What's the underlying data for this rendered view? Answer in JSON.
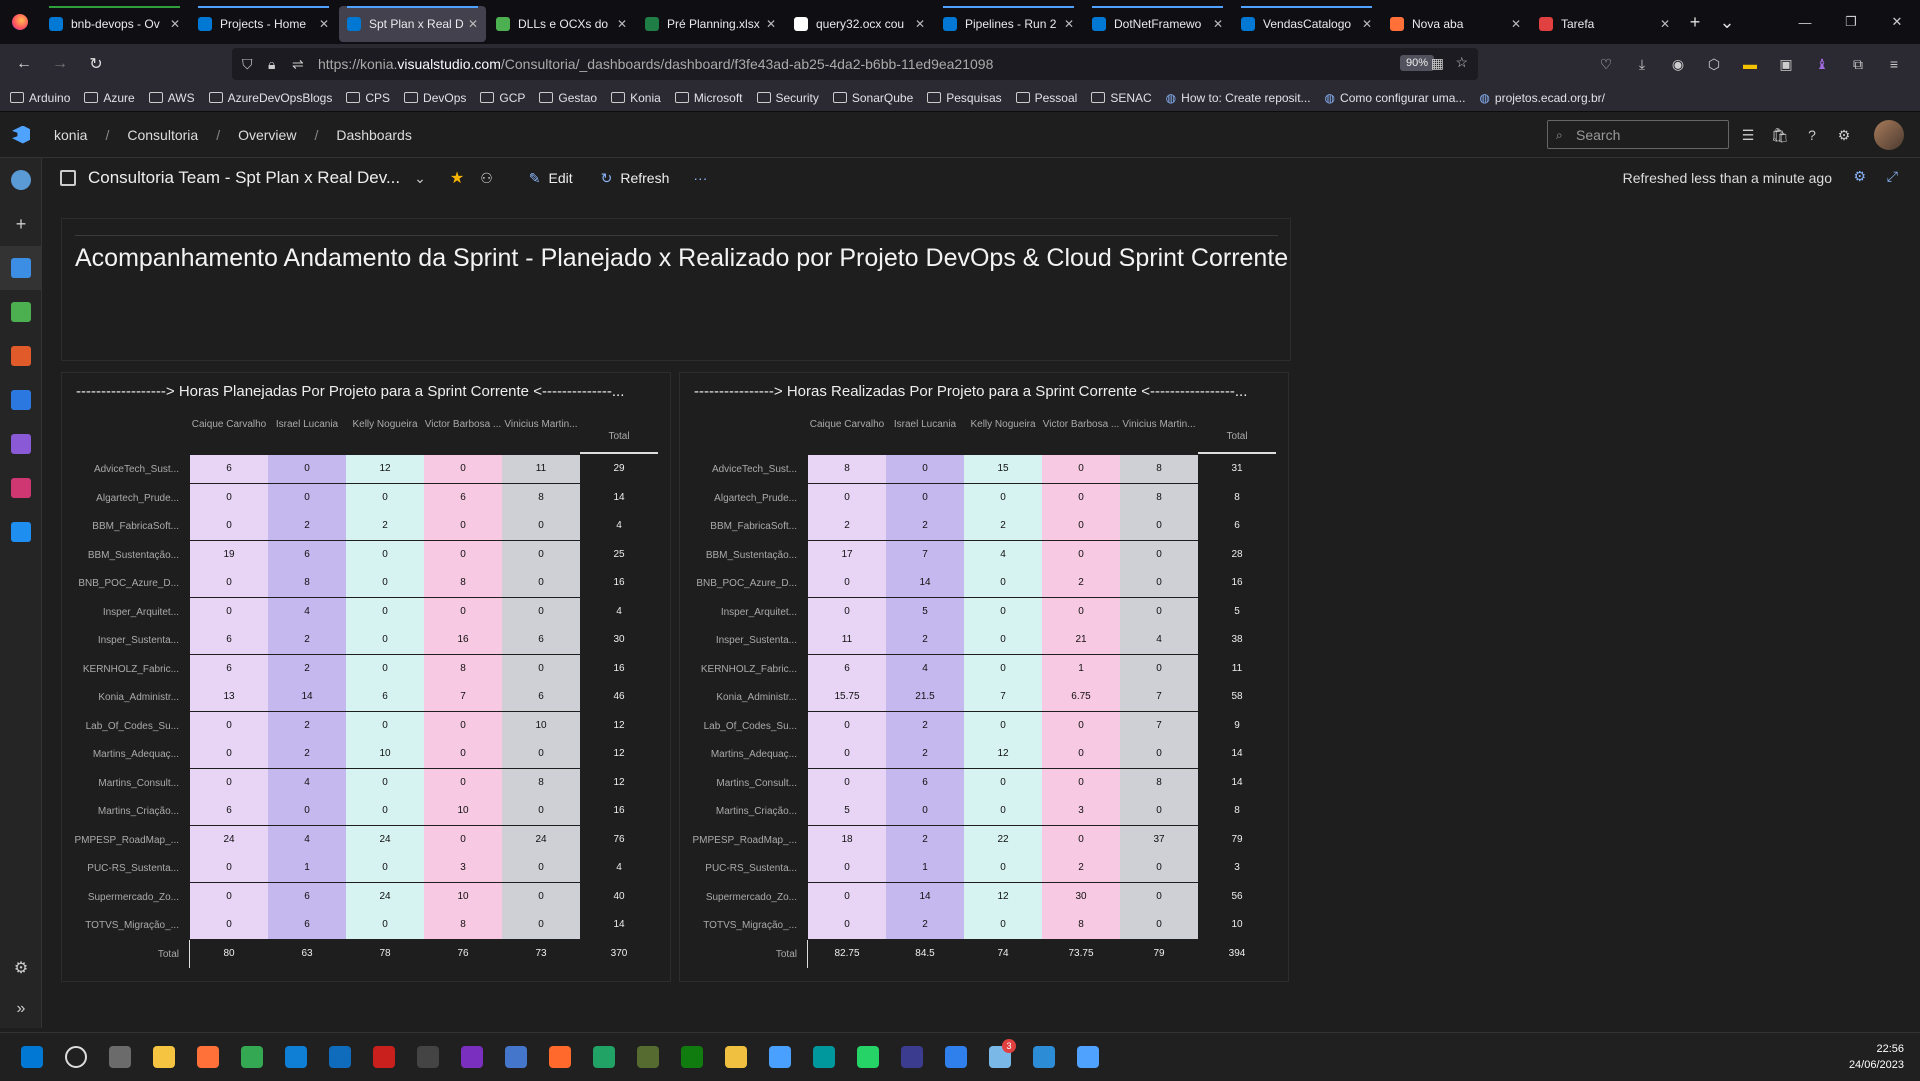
{
  "browser": {
    "tabs": [
      {
        "title": "bnb-devops - Ov",
        "color": "#0078d4"
      },
      {
        "title": "Projects - Home",
        "color": "#0078d4"
      },
      {
        "title": "Spt Plan x Real D",
        "color": "#0078d4",
        "active": true
      },
      {
        "title": "DLLs e OCXs do",
        "color": "#4caf50"
      },
      {
        "title": "Pré Planning.xlsx",
        "color": "#1e7e45"
      },
      {
        "title": "query32.ocx cou",
        "color": "#ffffff"
      },
      {
        "title": "Pipelines - Run 2",
        "color": "#0078d4"
      },
      {
        "title": "DotNetFramewo",
        "color": "#0078d4"
      },
      {
        "title": "VendasCatalogo",
        "color": "#0078d4"
      },
      {
        "title": "Nova aba",
        "color": "#ff7139"
      },
      {
        "title": "Tarefa",
        "color": "#e04040"
      }
    ],
    "url_prefix": "https://konia.",
    "url_domain": "visualstudio.com",
    "url_rest": "/Consultoria/_dashboards/dashboard/f3fe43ad-ab25-4da2-b6bb-11ed9ea21098",
    "zoom": "90%",
    "bookmarks": [
      "Arduino",
      "Azure",
      "AWS",
      "AzureDevOpsBlogs",
      "CPS",
      "DevOps",
      "GCP",
      "Gestao",
      "Konia",
      "Microsoft",
      "Security",
      "SonarQube",
      "Pesquisas",
      "Pessoal",
      "SENAC"
    ],
    "bookmark_links": [
      "How to: Create reposit...",
      "Como configurar uma...",
      "projetos.ecad.org.br/"
    ]
  },
  "ado": {
    "breadcrumb": [
      "konia",
      "Consultoria",
      "Overview",
      "Dashboards"
    ],
    "search_placeholder": "Search",
    "dashboard_title": "Consultoria Team - Spt Plan x Real Dev...",
    "edit_label": "Edit",
    "refresh_label": "Refresh",
    "more_label": "···",
    "refreshed_text": "Refreshed less than a minute ago"
  },
  "main_title": "Acompanhamento Andamento da Sprint - Planejado x Realizado por Projeto DevOps & Cloud Sprint Corrente",
  "tables": [
    {
      "title": "------------------> Horas Planejadas Por Projeto para a Sprint Corrente <--------------...",
      "columns": [
        "Caique Carvalho",
        "Israel Lucania",
        "Kelly Nogueira",
        "Victor Barbosa ...",
        "Vinicius Martin..."
      ],
      "total_label": "Total",
      "rows": [
        {
          "label": "AdviceTech_Sust...",
          "values": [
            "6",
            "0",
            "12",
            "0",
            "11"
          ],
          "total": "29"
        },
        {
          "label": "Algartech_Prude...",
          "values": [
            "0",
            "0",
            "0",
            "6",
            "8"
          ],
          "total": "14"
        },
        {
          "label": "BBM_FabricaSoft...",
          "values": [
            "0",
            "2",
            "2",
            "0",
            "0"
          ],
          "total": "4"
        },
        {
          "label": "BBM_Sustentação...",
          "values": [
            "19",
            "6",
            "0",
            "0",
            "0"
          ],
          "total": "25"
        },
        {
          "label": "BNB_POC_Azure_D...",
          "values": [
            "0",
            "8",
            "0",
            "8",
            "0"
          ],
          "total": "16"
        },
        {
          "label": "Insper_Arquitet...",
          "values": [
            "0",
            "4",
            "0",
            "0",
            "0"
          ],
          "total": "4"
        },
        {
          "label": "Insper_Sustenta...",
          "values": [
            "6",
            "2",
            "0",
            "16",
            "6"
          ],
          "total": "30"
        },
        {
          "label": "KERNHOLZ_Fabric...",
          "values": [
            "6",
            "2",
            "0",
            "8",
            "0"
          ],
          "total": "16"
        },
        {
          "label": "Konia_Administr...",
          "values": [
            "13",
            "14",
            "6",
            "7",
            "6"
          ],
          "total": "46"
        },
        {
          "label": "Lab_Of_Codes_Su...",
          "values": [
            "0",
            "2",
            "0",
            "0",
            "10"
          ],
          "total": "12"
        },
        {
          "label": "Martins_Adequaç...",
          "values": [
            "0",
            "2",
            "10",
            "0",
            "0"
          ],
          "total": "12"
        },
        {
          "label": "Martins_Consult...",
          "values": [
            "0",
            "4",
            "0",
            "0",
            "8"
          ],
          "total": "12"
        },
        {
          "label": "Martins_Criação...",
          "values": [
            "6",
            "0",
            "0",
            "10",
            "0"
          ],
          "total": "16"
        },
        {
          "label": "PMPESP_RoadMap_...",
          "values": [
            "24",
            "4",
            "24",
            "0",
            "24"
          ],
          "total": "76"
        },
        {
          "label": "PUC-RS_Sustenta...",
          "values": [
            "0",
            "1",
            "0",
            "3",
            "0"
          ],
          "total": "4"
        },
        {
          "label": "Supermercado_Zo...",
          "values": [
            "0",
            "6",
            "24",
            "10",
            "0"
          ],
          "total": "40"
        },
        {
          "label": "TOTVS_Migração_...",
          "values": [
            "0",
            "6",
            "0",
            "8",
            "0"
          ],
          "total": "14"
        }
      ],
      "footer": {
        "label": "Total",
        "values": [
          "80",
          "63",
          "78",
          "76",
          "73"
        ],
        "total": "370"
      }
    },
    {
      "title": "----------------> Horas Realizadas Por Projeto para a Sprint Corrente <-----------------...",
      "columns": [
        "Caique Carvalho",
        "Israel Lucania",
        "Kelly Nogueira",
        "Victor Barbosa ...",
        "Vinicius Martin..."
      ],
      "total_label": "Total",
      "rows": [
        {
          "label": "AdviceTech_Sust...",
          "values": [
            "8",
            "0",
            "15",
            "0",
            "8"
          ],
          "total": "31"
        },
        {
          "label": "Algartech_Prude...",
          "values": [
            "0",
            "0",
            "0",
            "0",
            "8"
          ],
          "total": "8"
        },
        {
          "label": "BBM_FabricaSoft...",
          "values": [
            "2",
            "2",
            "2",
            "0",
            "0"
          ],
          "total": "6"
        },
        {
          "label": "BBM_Sustentação...",
          "values": [
            "17",
            "7",
            "4",
            "0",
            "0"
          ],
          "total": "28"
        },
        {
          "label": "BNB_POC_Azure_D...",
          "values": [
            "0",
            "14",
            "0",
            "2",
            "0"
          ],
          "total": "16"
        },
        {
          "label": "Insper_Arquitet...",
          "values": [
            "0",
            "5",
            "0",
            "0",
            "0"
          ],
          "total": "5"
        },
        {
          "label": "Insper_Sustenta...",
          "values": [
            "11",
            "2",
            "0",
            "21",
            "4"
          ],
          "total": "38"
        },
        {
          "label": "KERNHOLZ_Fabric...",
          "values": [
            "6",
            "4",
            "0",
            "1",
            "0"
          ],
          "total": "11"
        },
        {
          "label": "Konia_Administr...",
          "values": [
            "15.75",
            "21.5",
            "7",
            "6.75",
            "7"
          ],
          "total": "58"
        },
        {
          "label": "Lab_Of_Codes_Su...",
          "values": [
            "0",
            "2",
            "0",
            "0",
            "7"
          ],
          "total": "9"
        },
        {
          "label": "Martins_Adequaç...",
          "values": [
            "0",
            "2",
            "12",
            "0",
            "0"
          ],
          "total": "14"
        },
        {
          "label": "Martins_Consult...",
          "values": [
            "0",
            "6",
            "0",
            "0",
            "8"
          ],
          "total": "14"
        },
        {
          "label": "Martins_Criação...",
          "values": [
            "5",
            "0",
            "0",
            "3",
            "0"
          ],
          "total": "8"
        },
        {
          "label": "PMPESP_RoadMap_...",
          "values": [
            "18",
            "2",
            "22",
            "0",
            "37"
          ],
          "total": "79"
        },
        {
          "label": "PUC-RS_Sustenta...",
          "values": [
            "0",
            "1",
            "0",
            "2",
            "0"
          ],
          "total": "3"
        },
        {
          "label": "Supermercado_Zo...",
          "values": [
            "0",
            "14",
            "12",
            "30",
            "0"
          ],
          "total": "56"
        },
        {
          "label": "TOTVS_Migração_...",
          "values": [
            "0",
            "2",
            "0",
            "8",
            "0"
          ],
          "total": "10"
        }
      ],
      "footer": {
        "label": "Total",
        "values": [
          "82.75",
          "84.5",
          "74",
          "73.75",
          "79"
        ],
        "total": "394"
      }
    }
  ],
  "colors": {
    "col_colors": [
      "#e8d5f5",
      "#c5b8ee",
      "#d7f3f1",
      "#f7c9e2",
      "#cfcfd6"
    ],
    "accent": "#4fa3ff"
  },
  "taskbar": {
    "clock_time": "22:56",
    "clock_date": "24/06/2023",
    "notif_badge": "3"
  }
}
